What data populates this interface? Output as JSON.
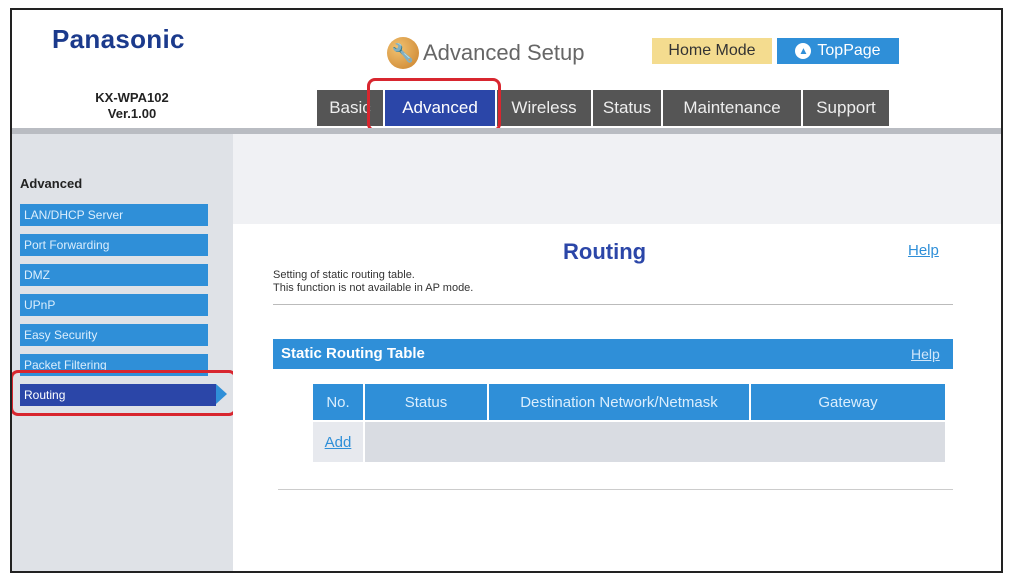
{
  "header": {
    "brand": "Panasonic",
    "model_line1": "KX-WPA102",
    "model_line2": "Ver.1.00",
    "title": "Advanced Setup",
    "home_mode": "Home Mode",
    "top_page": "TopPage",
    "icon_wrench": "wrench-icon",
    "icon_up": "up-arrow-icon"
  },
  "tabs": [
    {
      "label": "Basic"
    },
    {
      "label": "Advanced"
    },
    {
      "label": "Wireless"
    },
    {
      "label": "Status"
    },
    {
      "label": "Maintenance"
    },
    {
      "label": "Support"
    }
  ],
  "sidebar": {
    "heading": "Advanced",
    "items": [
      {
        "label": "LAN/DHCP Server"
      },
      {
        "label": "Port Forwarding"
      },
      {
        "label": "DMZ"
      },
      {
        "label": "UPnP"
      },
      {
        "label": "Easy Security"
      },
      {
        "label": "Packet Filtering"
      },
      {
        "label": "Routing"
      }
    ]
  },
  "main": {
    "title": "Routing",
    "help": "Help",
    "desc_line1": "Setting of static routing table.",
    "desc_line2": "This function is not available in AP mode.",
    "section_title": "Static Routing Table",
    "section_help": "Help",
    "columns": [
      "No.",
      "Status",
      "Destination Network/Netmask",
      "Gateway"
    ],
    "add_label": "Add"
  },
  "colors": {
    "brand_blue": "#1b3a8c",
    "accent_blue": "#2f8fd8",
    "active_blue": "#2b46a8",
    "highlight_red": "#d8262f",
    "home_mode_bg": "#f4dc8f"
  }
}
